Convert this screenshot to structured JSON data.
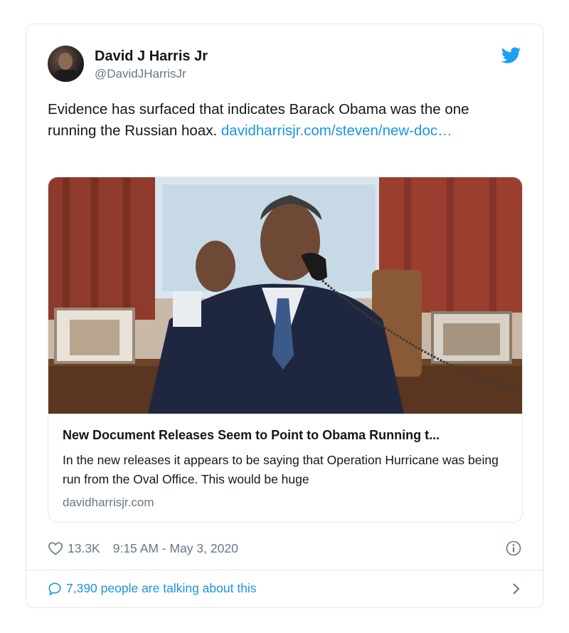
{
  "author": {
    "name": "David J Harris Jr",
    "handle": "@DavidJHarrisJr"
  },
  "tweet": {
    "text": "Evidence has surfaced that indicates Barack Obama was the one running the Russian hoax. ",
    "link": "davidharrisjr.com/steven/new-doc…"
  },
  "link_card": {
    "title": "New Document Releases Seem to Point to Obama Running t...",
    "description": "In the new releases it appears to be saying that Operation Hurricane was being run from the Oval Office. This would be huge",
    "domain": "davidharrisjr.com"
  },
  "stats": {
    "likes": "13.3K",
    "timestamp": "9:15 AM - May 3, 2020"
  },
  "footer": {
    "talking": "7,390 people are talking about this"
  },
  "icons": {
    "brand": "twitter-bird-icon",
    "like": "heart-icon",
    "info": "info-icon",
    "reply": "speech-bubble-icon",
    "more": "chevron-right-icon"
  },
  "colors": {
    "link": "#1b95e0",
    "muted": "#657786",
    "border": "#e1e8ed"
  }
}
